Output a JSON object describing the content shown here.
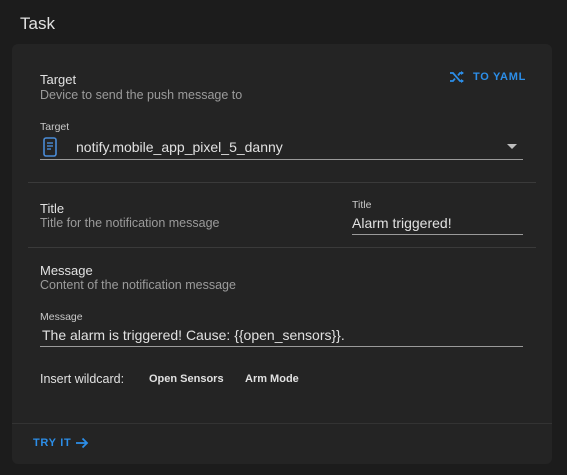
{
  "header": {
    "title": "Task"
  },
  "target": {
    "label": "Target",
    "description": "Device to send the push message to",
    "to_yaml_label": "TO YAML",
    "field_caption": "Target",
    "selected_value": "notify.mobile_app_pixel_5_danny"
  },
  "title_section": {
    "label": "Title",
    "description": "Title for the notification message",
    "field_caption": "Title",
    "value": "Alarm triggered!"
  },
  "message_section": {
    "label": "Message",
    "description": "Content of the notification message",
    "field_caption": "Message",
    "value": "The alarm is triggered! Cause: {{open_sensors}}."
  },
  "wildcards": {
    "label": "Insert wildcard:",
    "options": [
      "Open Sensors",
      "Arm Mode"
    ]
  },
  "footer": {
    "try_it_label": "TRY IT"
  },
  "colors": {
    "accent": "#2c8ee8",
    "background": "#1c1c1c",
    "card": "#242424",
    "text": "#e1e1e1",
    "muted": "#9b9b9b"
  },
  "icons": {
    "to_yaml": "shuffle-icon",
    "target_field": "phone-device-icon",
    "dropdown": "triangle-down-icon",
    "try_it": "arrow-right-icon"
  }
}
